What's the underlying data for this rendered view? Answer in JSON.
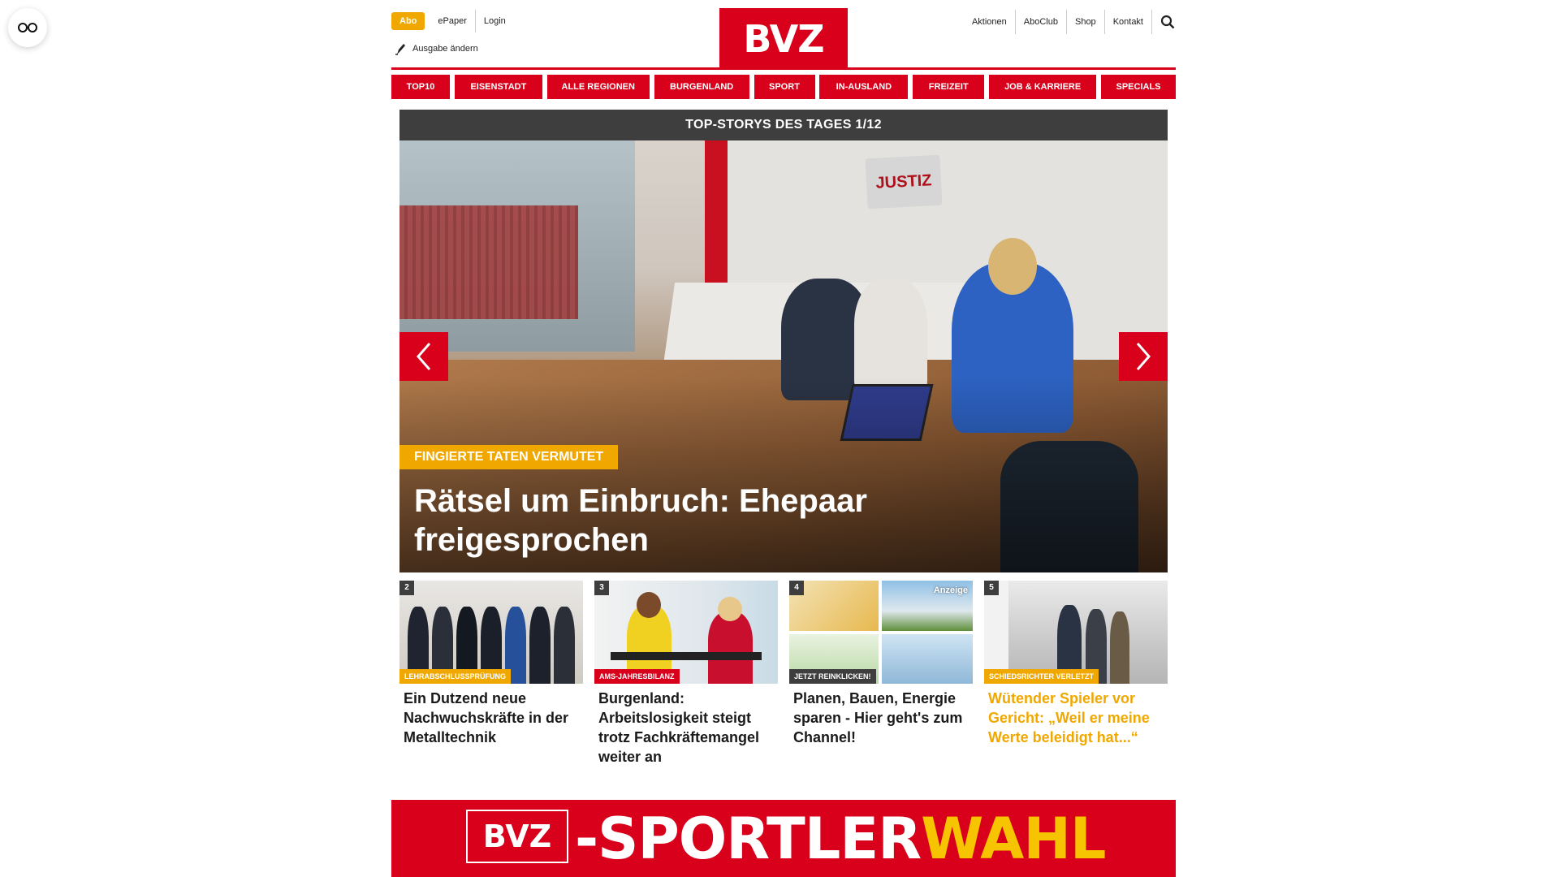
{
  "top_left": {
    "abo": "Abo",
    "epaper": "ePaper",
    "login": "Login",
    "ausgabe": "Ausgabe ändern"
  },
  "logo": "BVZ",
  "top_right": {
    "aktionen": "Aktionen",
    "aboclub": "AboClub",
    "shop": "Shop",
    "kontakt": "Kontakt"
  },
  "nav": [
    "TOP10",
    "EISENSTADT",
    "ALLE REGIONEN",
    "BURGENLAND",
    "SPORT",
    "IN-AUSLAND",
    "FREIZEIT",
    "JOB & KARRIERE",
    "SPECIALS"
  ],
  "hero": {
    "heading": "TOP-STORYS DES TAGES 1/12",
    "kicker": "FINGIERTE TATEN VERMUTET",
    "title": "Rätsel um Einbruch: Ehepaar freigesprochen",
    "sign": "JUSTIZ"
  },
  "cards": [
    {
      "num": "2",
      "tag": "LEHRABSCHLUSSPRÜFUNG",
      "title": "Ein Dutzend neue Nachwuchskräfte in der Metalltechnik"
    },
    {
      "num": "3",
      "tag": "AMS-JAHRESBILANZ",
      "title": "Burgenland: Arbeitslosigkeit steigt trotz Fachkräftemangel weiter an"
    },
    {
      "num": "4",
      "tag": "JETZT REINKLICKEN!",
      "title": "Planen, Bauen, Energie sparen - Hier geht's zum Channel!",
      "ad": "Anzeige"
    },
    {
      "num": "5",
      "tag": "SCHIEDSRICHTER VERLETZT",
      "title": "Wütender Spieler vor Gericht: „Weil er meine Werte beleidigt hat...“"
    }
  ],
  "banner": {
    "logo": "BVZ",
    "text_a": "-SPORTLER",
    "text_b": "WAHL"
  },
  "colors": {
    "brand_red": "#d8001a",
    "accent_yellow": "#f0a800",
    "dark": "#3e3e3e"
  },
  "icons": {
    "reader": "glasses-icon",
    "search": "search-icon",
    "ausgabe": "pen-icon",
    "prev": "chevron-left-icon",
    "next": "chevron-right-icon"
  }
}
